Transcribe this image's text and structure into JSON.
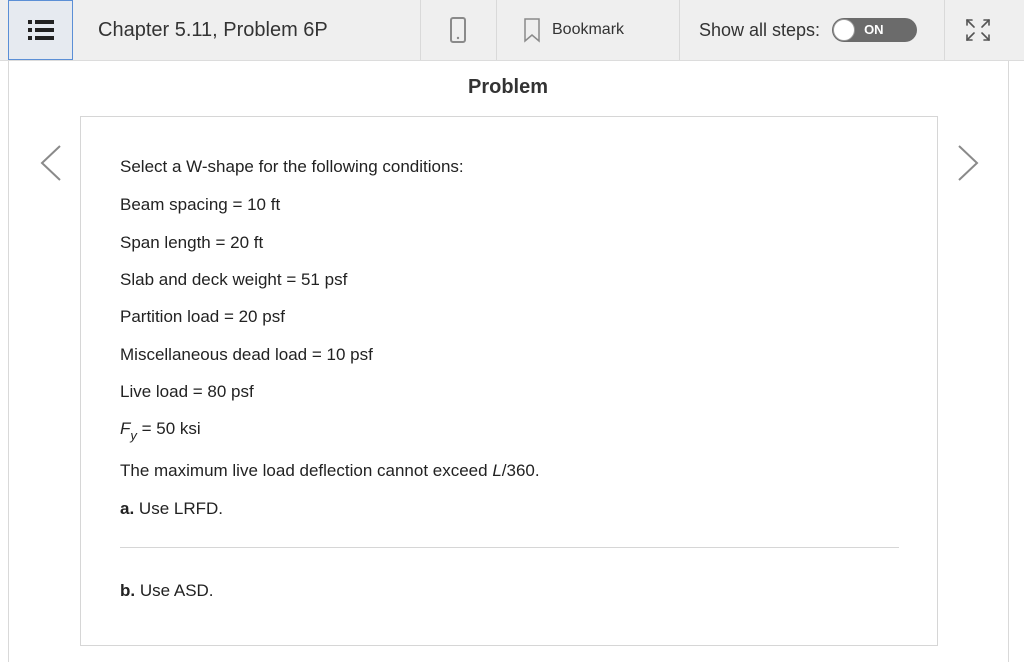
{
  "toolbar": {
    "title": "Chapter 5.11, Problem 6P",
    "bookmark_label": "Bookmark",
    "show_steps_label": "Show all steps:",
    "toggle_state": "ON"
  },
  "section_title": "Problem",
  "problem": {
    "intro": "Select a W-shape for the following conditions:",
    "conditions": [
      "Beam spacing = 10 ft",
      "Span length = 20 ft",
      "Slab and deck weight = 51 psf",
      "Partition load = 20 psf",
      "Miscellaneous dead load = 10 psf",
      "Live load = 80 psf"
    ],
    "fy_symbol": "F",
    "fy_sub": "y",
    "fy_value": " = 50 ksi",
    "deflection_prefix": "The maximum live load deflection cannot exceed ",
    "deflection_var": "L",
    "deflection_suffix": "/360.",
    "part_a_label": "a.",
    "part_a_text": " Use LRFD.",
    "part_b_label": "b.",
    "part_b_text": " Use ASD."
  },
  "icons": {
    "menu": "list-menu-icon",
    "device": "mobile-device-icon",
    "bookmark": "bookmark-icon",
    "expand": "expand-arrows-icon",
    "prev": "chevron-left-icon",
    "next": "chevron-right-icon"
  },
  "colors": {
    "toolbar_bg": "#efefef",
    "menu_accent": "#5b8fd6",
    "toggle_bg": "#6b6b6b"
  }
}
